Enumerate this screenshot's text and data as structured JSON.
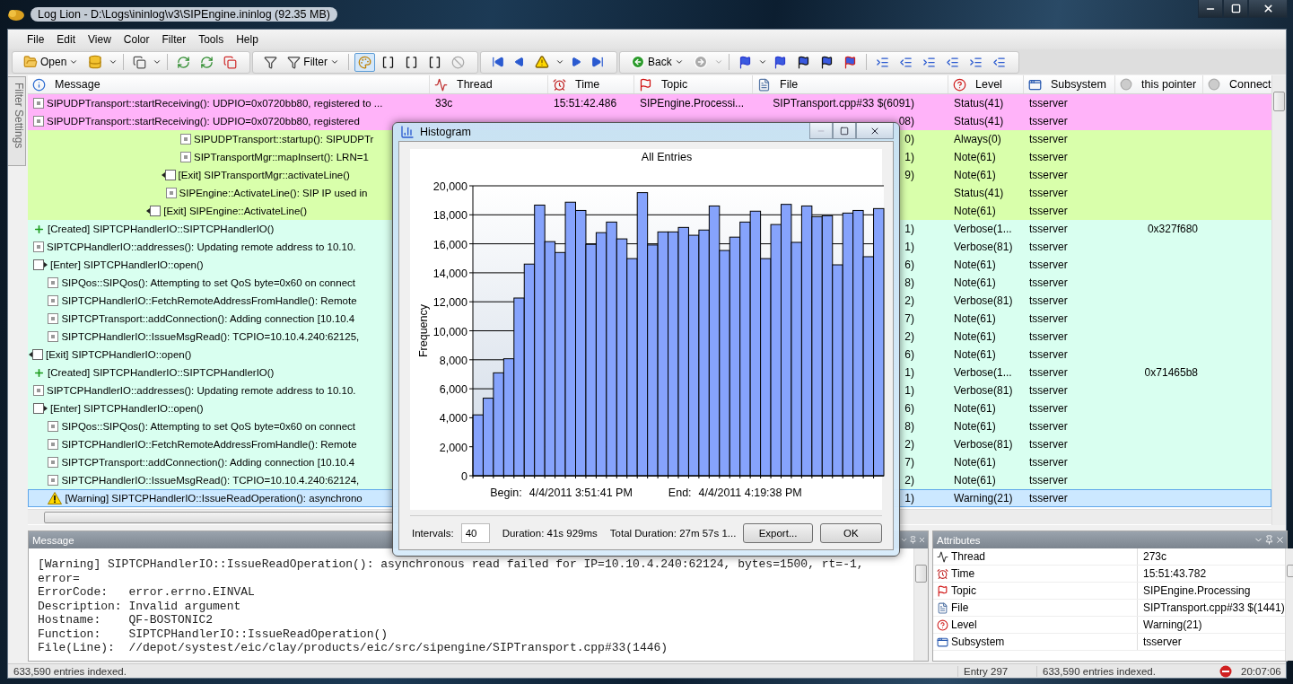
{
  "window": {
    "title": "Log Lion - D:\\Logs\\ininlog\\v3\\SIPEngine.ininlog (92.35 MB)"
  },
  "menu": [
    "File",
    "Edit",
    "View",
    "Color",
    "Filter",
    "Tools",
    "Help"
  ],
  "toolbar": {
    "open_label": "Open",
    "filter_label": "Filter",
    "back_label": "Back",
    "highlight_pressed": true,
    "clear_disabled": true,
    "forward_disabled": true
  },
  "side_tab": {
    "label": "Filter Settings"
  },
  "columns": [
    {
      "label": "Message"
    },
    {
      "label": "Thread"
    },
    {
      "label": "Time"
    },
    {
      "label": "Topic"
    },
    {
      "label": "File"
    },
    {
      "label": "Level"
    },
    {
      "label": "Subsystem"
    },
    {
      "label": "this pointer"
    },
    {
      "label": "Connect"
    }
  ],
  "rows": [
    {
      "kind": "trace",
      "message": "SIPUDPTransport::startReceiving(): UDPIO=0x0720bb80, registered to ...",
      "thread": "33c",
      "time": "15:51:42.486",
      "topic": "SIPEngine.Processi...",
      "file": "SIPTransport.cpp#33 $(6091)",
      "level": "Status(41)",
      "subsystem": "tsserver",
      "color": "#ffb3f9",
      "selected": false
    },
    {
      "kind": "trace",
      "message": "SIPUDPTransport::startReceiving(): UDPIO=0x0720bb80, registered",
      "file": "08)",
      "level": "Status(41)",
      "subsystem": "tsserver",
      "color": "#ffb3f9",
      "selected": false
    },
    {
      "children": [
        {
          "children": [
            {
              "children": [
                {
                  "children": [
                    {
                      "children": [
                        {
                          "children": [
                            {
                              "children": [
                                {
                                  "children": [
                                    {
                                      "children": [
                                        {
                                          "children": [
                                            {
                                              "kind": "trace",
                                              "message": "SIPUDPTransport::startup(): SIPUDPTr",
                                              "file": "0)",
                                              "level": "Always(0)",
                                              "subsystem": "tsserver",
                                              "color": "#d9ffab",
                                              "selected": false
                                            },
                                            {
                                              "kind": "trace",
                                              "message": "SIPTransportMgr::mapInsert(): LRN=1",
                                              "file": "1)",
                                              "level": "Note(61)",
                                              "subsystem": "tsserver",
                                              "color": "#d9ffab",
                                              "selected": false
                                            }
                                          ]
                                        },
                                        {
                                          "kind": "exit",
                                          "message": "[Exit] SIPTransportMgr::activateLine()",
                                          "file": "9)",
                                          "level": "Note(61)",
                                          "subsystem": "tsserver",
                                          "color": "#d9ffab",
                                          "selected": false
                                        },
                                        {
                                          "kind": "trace",
                                          "message": "SIPEngine::ActivateLine(): SIP IP used in",
                                          "level": "Status(41)",
                                          "subsystem": "tsserver",
                                          "color": "#d9ffab",
                                          "selected": false
                                        }
                                      ]
                                    },
                                    {
                                      "kind": "exit",
                                      "message": "[Exit] SIPEngine::ActivateLine()",
                                      "level": "Note(61)",
                                      "subsystem": "tsserver",
                                      "color": "#d9ffab",
                                      "selected": false
                                    }
                                  ]
                                }
                              ]
                            }
                          ]
                        }
                      ]
                    }
                  ]
                }
              ]
            }
          ]
        }
      ]
    },
    {
      "kind": "created",
      "message": "[Created] SIPTCPHandlerIO::SIPTCPHandlerIO()",
      "file": "1)",
      "level": "Verbose(1...",
      "subsystem": "tsserver",
      "this_pointer": "0x327f680",
      "color": "#d9fff0",
      "selected": false
    },
    {
      "kind": "trace",
      "message": "SIPTCPHandlerIO::addresses(): Updating remote address to 10.10.",
      "file": "1)",
      "level": "Verbose(81)",
      "subsystem": "tsserver",
      "color": "#d9fff0",
      "selected": false
    },
    {
      "kind": "enter",
      "message": "[Enter] SIPTCPHandlerIO::open()",
      "file": "6)",
      "level": "Note(61)",
      "subsystem": "tsserver",
      "color": "#d9fff0",
      "selected": false,
      "children": [
        {
          "kind": "trace",
          "message": "SIPQos::SIPQos(): Attempting to set QoS byte=0x60 on connect",
          "file": "8)",
          "level": "Note(61)",
          "subsystem": "tsserver",
          "color": "#d9fff0",
          "selected": false
        },
        {
          "kind": "trace",
          "message": "SIPTCPHandlerIO::FetchRemoteAddressFromHandle(): Remote",
          "file": "2)",
          "level": "Verbose(81)",
          "subsystem": "tsserver",
          "color": "#d9fff0",
          "selected": false
        },
        {
          "kind": "trace",
          "message": "SIPTCPTransport::addConnection(): Adding connection [10.10.4",
          "file": "7)",
          "level": "Note(61)",
          "subsystem": "tsserver",
          "color": "#d9fff0",
          "selected": false
        },
        {
          "kind": "trace",
          "message": "SIPTCPHandlerIO::IssueMsgRead(): TCPIO=10.10.4.240:62125,",
          "file": "2)",
          "level": "Note(61)",
          "subsystem": "tsserver",
          "color": "#d9fff0",
          "selected": false
        }
      ]
    },
    {
      "kind": "exit",
      "message": "[Exit] SIPTCPHandlerIO::open()",
      "file": "6)",
      "level": "Note(61)",
      "subsystem": "tsserver",
      "color": "#d9fff0",
      "selected": false
    },
    {
      "kind": "created",
      "message": "[Created] SIPTCPHandlerIO::SIPTCPHandlerIO()",
      "file": "1)",
      "level": "Verbose(1...",
      "subsystem": "tsserver",
      "this_pointer": "0x71465b8",
      "color": "#d9fff0",
      "selected": false
    },
    {
      "kind": "trace",
      "message": "SIPTCPHandlerIO::addresses(): Updating remote address to 10.10.",
      "file": "1)",
      "level": "Verbose(81)",
      "subsystem": "tsserver",
      "color": "#d9fff0",
      "selected": false
    },
    {
      "kind": "enter",
      "message": "[Enter] SIPTCPHandlerIO::open()",
      "file": "6)",
      "level": "Note(61)",
      "subsystem": "tsserver",
      "color": "#d9fff0",
      "selected": false,
      "children": [
        {
          "kind": "trace",
          "message": "SIPQos::SIPQos(): Attempting to set QoS byte=0x60 on connect",
          "file": "8)",
          "level": "Note(61)",
          "subsystem": "tsserver",
          "color": "#d9fff0",
          "selected": false
        },
        {
          "kind": "trace",
          "message": "SIPTCPHandlerIO::FetchRemoteAddressFromHandle(): Remote",
          "file": "2)",
          "level": "Verbose(81)",
          "subsystem": "tsserver",
          "color": "#d9fff0",
          "selected": false
        },
        {
          "kind": "trace",
          "message": "SIPTCPTransport::addConnection(): Adding connection [10.10.4",
          "file": "7)",
          "level": "Note(61)",
          "subsystem": "tsserver",
          "color": "#d9fff0",
          "selected": false
        },
        {
          "kind": "trace",
          "message": "SIPTCPHandlerIO::IssueMsgRead(): TCPIO=10.10.4.240:62124,",
          "file": "2)",
          "level": "Note(61)",
          "subsystem": "tsserver",
          "color": "#d9fff0",
          "selected": false
        },
        {
          "kind": "warning",
          "message": "[Warning] SIPTCPHandlerIO::IssueReadOperation(): asynchrono",
          "file": "1)",
          "level": "Warning(21)",
          "subsystem": "tsserver",
          "selected": true
        }
      ]
    }
  ],
  "message_panel": {
    "title": "Message",
    "lines": [
      "[Warning] SIPTCPHandlerIO::IssueReadOperation(): asynchronous read failed for IP=10.10.4.240:62124, bytes=1500, rt=-1,",
      "error=",
      "ErrorCode:   error.errno.EINVAL",
      "Description: Invalid argument",
      "Hostname:    QF-BOSTONIC2",
      "Function:    SIPTCPHandlerIO::IssueReadOperation()",
      "File(Line):  //depot/systest/eic/clay/products/eic/src/sipengine/SIPTransport.cpp#33(1446)"
    ]
  },
  "attributes_panel": {
    "title": "Attributes",
    "rows": [
      {
        "name": "Thread",
        "value": "273c"
      },
      {
        "name": "Time",
        "value": "15:51:43.782"
      },
      {
        "name": "Topic",
        "value": "SIPEngine.Processing"
      },
      {
        "name": "File",
        "value": "SIPTransport.cpp#33 $(1441)"
      },
      {
        "name": "Level",
        "value": "Warning(21)"
      },
      {
        "name": "Subsystem",
        "value": "tsserver"
      }
    ]
  },
  "status_bar": {
    "left": "633,590 entries indexed.",
    "entry": "Entry 297",
    "indexed": "633,590 entries indexed.",
    "time": "20:07:06"
  },
  "histogram": {
    "title": "Histogram",
    "chart_data": {
      "type": "bar",
      "title": "All Entries",
      "ylabel": "Frequency",
      "ylim": [
        0,
        20000
      ],
      "grid": true,
      "yticks": [
        {
          "value": 0,
          "label": "0"
        },
        {
          "value": 2000,
          "label": "2,000"
        },
        {
          "value": 4000,
          "label": "4,000"
        },
        {
          "value": 6000,
          "label": "6,000"
        },
        {
          "value": 8000,
          "label": "8,000"
        },
        {
          "value": 10000,
          "label": "10,000"
        },
        {
          "value": 12000,
          "label": "12,000"
        },
        {
          "value": 14000,
          "label": "14,000"
        },
        {
          "value": 16000,
          "label": "16,000"
        },
        {
          "value": 18000,
          "label": "18,000"
        },
        {
          "value": 20000,
          "label": "20,000"
        }
      ],
      "values": [
        4200,
        5350,
        7100,
        8070,
        12260,
        14600,
        18670,
        16150,
        15400,
        18870,
        18300,
        15960,
        16770,
        17500,
        16340,
        14980,
        19530,
        15920,
        16820,
        16820,
        17130,
        16590,
        16950,
        18610,
        15540,
        16460,
        17500,
        18250,
        14980,
        17330,
        18720,
        16100,
        18610,
        17870,
        17940,
        14550,
        18120,
        18300,
        15110,
        18430
      ]
    },
    "begin_label": "Begin:",
    "begin": "4/4/2011 3:51:41 PM",
    "end_label": "End:",
    "end": "4/4/2011 4:19:38 PM",
    "intervals_label": "Intervals:",
    "intervals": "40",
    "duration": "Duration: 41s 929ms",
    "total_duration": "Total Duration: 27m 57s 1...",
    "buttons": [
      "Export...",
      "OK"
    ]
  }
}
